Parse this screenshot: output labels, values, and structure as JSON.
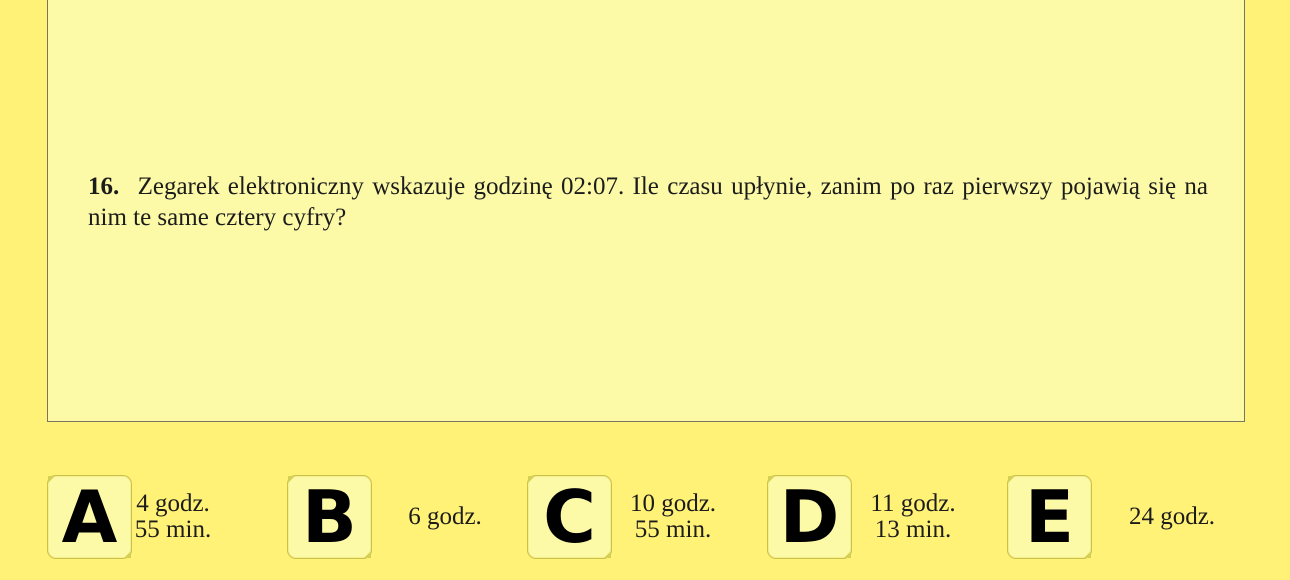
{
  "question": {
    "number": "16.",
    "text": "Zegarek elektroniczny wskazuje godzinę 02:07. Ile czasu upłynie, zanim po raz pierwszy pojawią się na nim te same cztery cyfry?"
  },
  "answers": [
    {
      "letter": "A",
      "line1": "4 godz.",
      "line2": "55 min."
    },
    {
      "letter": "B",
      "line1": "6 godz.",
      "line2": ""
    },
    {
      "letter": "C",
      "line1": "10 godz.",
      "line2": "55 min."
    },
    {
      "letter": "D",
      "line1": "11 godz.",
      "line2": "13 min."
    },
    {
      "letter": "E",
      "line1": "24 godz.",
      "line2": ""
    }
  ]
}
